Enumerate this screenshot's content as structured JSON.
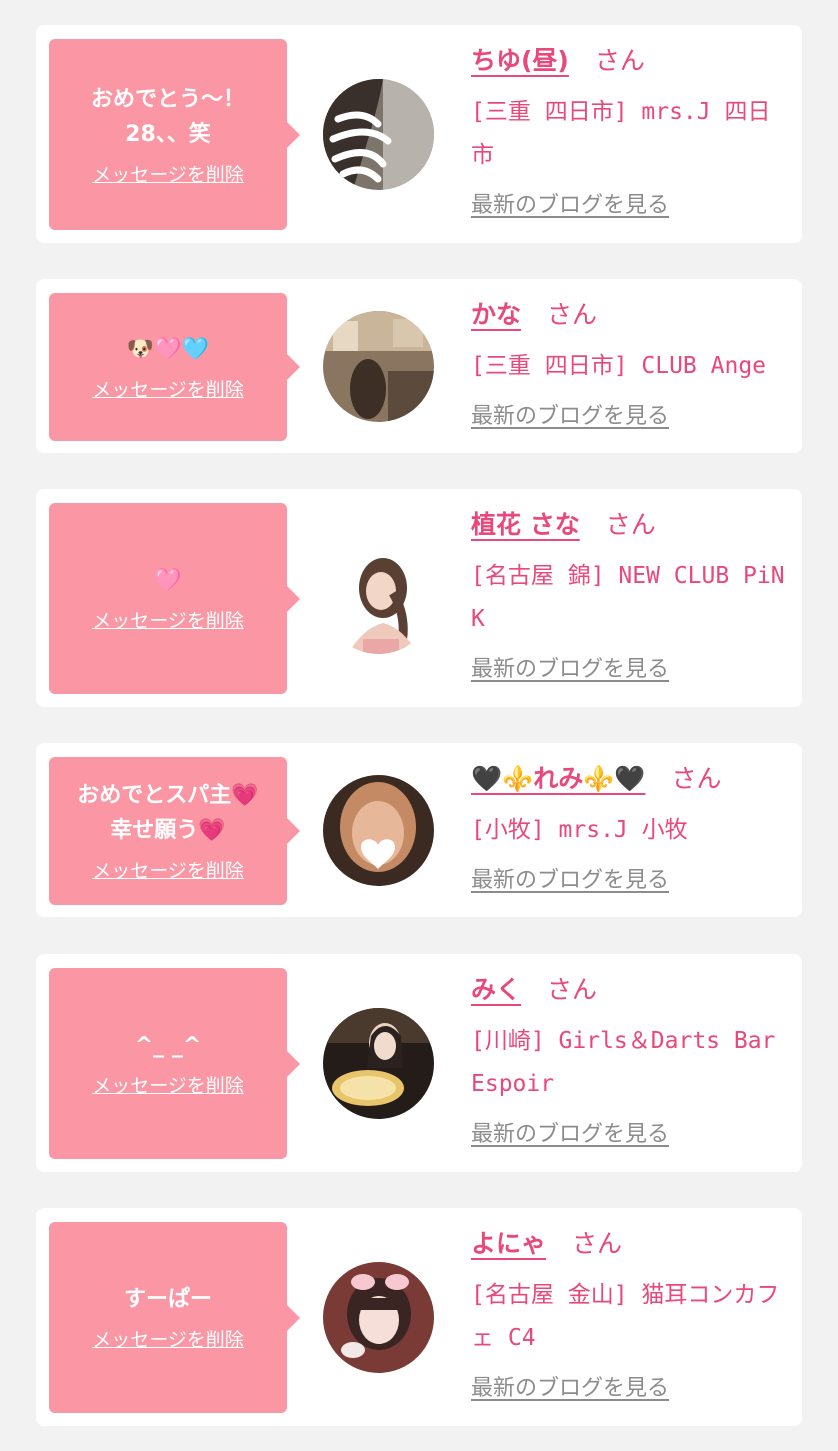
{
  "items": [
    {
      "message": "おめでとう〜！\n28、、笑",
      "delete_label": "メッセージを削除",
      "name": "ちゆ(昼)",
      "honorific": "さん",
      "shop": "[三重 四日市] mrs.J 四日市",
      "blog_label": "最新のブログを見る"
    },
    {
      "message": "🐶🩷🩵",
      "delete_label": "メッセージを削除",
      "name": "かな",
      "honorific": "さん",
      "shop": "[三重 四日市] CLUB Ange",
      "blog_label": "最新のブログを見る"
    },
    {
      "message": "🩷",
      "delete_label": "メッセージを削除",
      "name": "植花 さな",
      "honorific": "さん",
      "shop": "[名古屋 錦] NEW CLUB PiNK",
      "blog_label": "最新のブログを見る"
    },
    {
      "message": "おめでとスパ主💗\n幸せ願う💗",
      "delete_label": "メッセージを削除",
      "name": "🖤⚜️れみ⚜️🖤",
      "honorific": "さん",
      "shop": "[小牧] mrs.J 小牧",
      "blog_label": "最新のブログを見る"
    },
    {
      "message": "^_ _^",
      "delete_label": "メッセージを削除",
      "name": "みく",
      "honorific": "さん",
      "shop": "[川崎] Girls＆Darts Bar Espoir",
      "blog_label": "最新のブログを見る"
    },
    {
      "message": "すーぱー",
      "delete_label": "メッセージを削除",
      "name": "よにゃ",
      "honorific": "さん",
      "shop": "[名古屋 金山] 猫耳コンカフェ C4",
      "blog_label": "最新のブログを見る"
    }
  ],
  "colors": {
    "bubble": "#fb97a4",
    "accent": "#e8487a",
    "link_gray": "#8c8c8c",
    "background": "#f2f2f2"
  }
}
